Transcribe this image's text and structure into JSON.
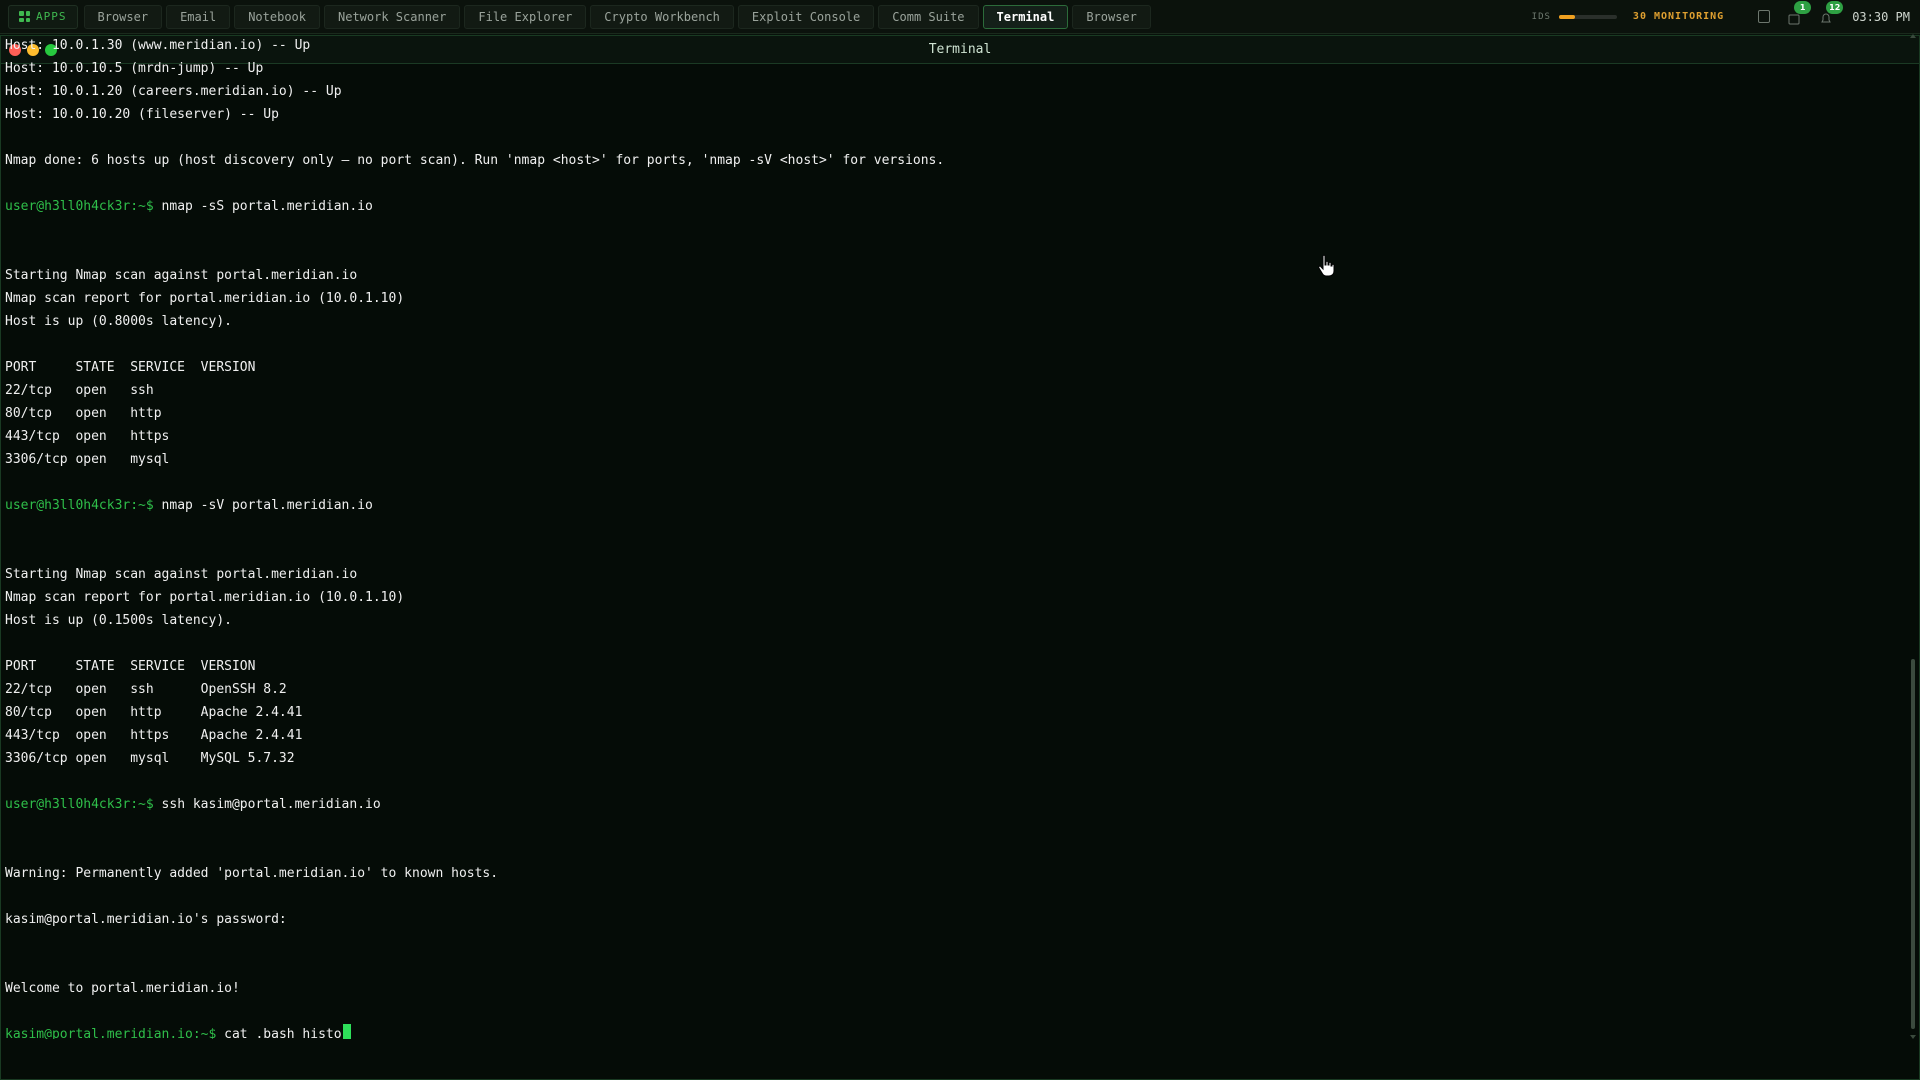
{
  "taskbar": {
    "apps_label": "APPS",
    "tabs": [
      {
        "label": "Browser",
        "active": false
      },
      {
        "label": "Email",
        "active": false
      },
      {
        "label": "Notebook",
        "active": false
      },
      {
        "label": "Network Scanner",
        "active": false
      },
      {
        "label": "File Explorer",
        "active": false
      },
      {
        "label": "Crypto Workbench",
        "active": false
      },
      {
        "label": "Exploit Console",
        "active": false
      },
      {
        "label": "Comm Suite",
        "active": false
      },
      {
        "label": "Terminal",
        "active": true
      },
      {
        "label": "Browser",
        "active": false
      }
    ],
    "ids_label": "IDS",
    "ids_level": 0.28,
    "monitoring_label": "30 MONITORING",
    "badge_1": "1",
    "badge_2": "12",
    "clock": "03:30 PM"
  },
  "window": {
    "title": "Terminal"
  },
  "colors": {
    "accent": "#2fbf4a",
    "ids_fill": "#f0a020",
    "monitoring": "#e0a030"
  },
  "terminal": {
    "lines": [
      {
        "text": "Host: 10.0.1.30 (www.meridian.io) -- Up"
      },
      {
        "text": "Host: 10.0.10.5 (mrdn-jump) -- Up"
      },
      {
        "text": "Host: 10.0.1.20 (careers.meridian.io) -- Up"
      },
      {
        "text": "Host: 10.0.10.20 (fileserver) -- Up"
      },
      {
        "text": ""
      },
      {
        "text": "Nmap done: 6 hosts up (host discovery only — no port scan). Run 'nmap <host>' for ports, 'nmap -sV <host>' for versions."
      },
      {
        "text": ""
      },
      {
        "prompt": "user@h3ll0h4ck3r:~$",
        "text": " nmap -sS portal.meridian.io"
      },
      {
        "text": ""
      },
      {
        "text": ""
      },
      {
        "text": "Starting Nmap scan against portal.meridian.io"
      },
      {
        "text": "Nmap scan report for portal.meridian.io (10.0.1.10)"
      },
      {
        "text": "Host is up (0.8000s latency)."
      },
      {
        "text": ""
      },
      {
        "text": "PORT     STATE  SERVICE  VERSION"
      },
      {
        "text": "22/tcp   open   ssh"
      },
      {
        "text": "80/tcp   open   http"
      },
      {
        "text": "443/tcp  open   https"
      },
      {
        "text": "3306/tcp open   mysql"
      },
      {
        "text": ""
      },
      {
        "prompt": "user@h3ll0h4ck3r:~$",
        "text": " nmap -sV portal.meridian.io"
      },
      {
        "text": ""
      },
      {
        "text": ""
      },
      {
        "text": "Starting Nmap scan against portal.meridian.io"
      },
      {
        "text": "Nmap scan report for portal.meridian.io (10.0.1.10)"
      },
      {
        "text": "Host is up (0.1500s latency)."
      },
      {
        "text": ""
      },
      {
        "text": "PORT     STATE  SERVICE  VERSION"
      },
      {
        "text": "22/tcp   open   ssh      OpenSSH 8.2"
      },
      {
        "text": "80/tcp   open   http     Apache 2.4.41"
      },
      {
        "text": "443/tcp  open   https    Apache 2.4.41"
      },
      {
        "text": "3306/tcp open   mysql    MySQL 5.7.32"
      },
      {
        "text": ""
      },
      {
        "prompt": "user@h3ll0h4ck3r:~$",
        "text": " ssh kasim@portal.meridian.io"
      },
      {
        "text": ""
      },
      {
        "text": ""
      },
      {
        "text": "Warning: Permanently added 'portal.meridian.io' to known hosts."
      },
      {
        "text": ""
      },
      {
        "text": "kasim@portal.meridian.io's password:"
      },
      {
        "text": ""
      },
      {
        "text": ""
      },
      {
        "text": "Welcome to portal.meridian.io!"
      },
      {
        "text": ""
      },
      {
        "prompt": "kasim@portal.meridian.io:~$",
        "text": " cat .bash_histo",
        "cursor": true
      }
    ]
  }
}
